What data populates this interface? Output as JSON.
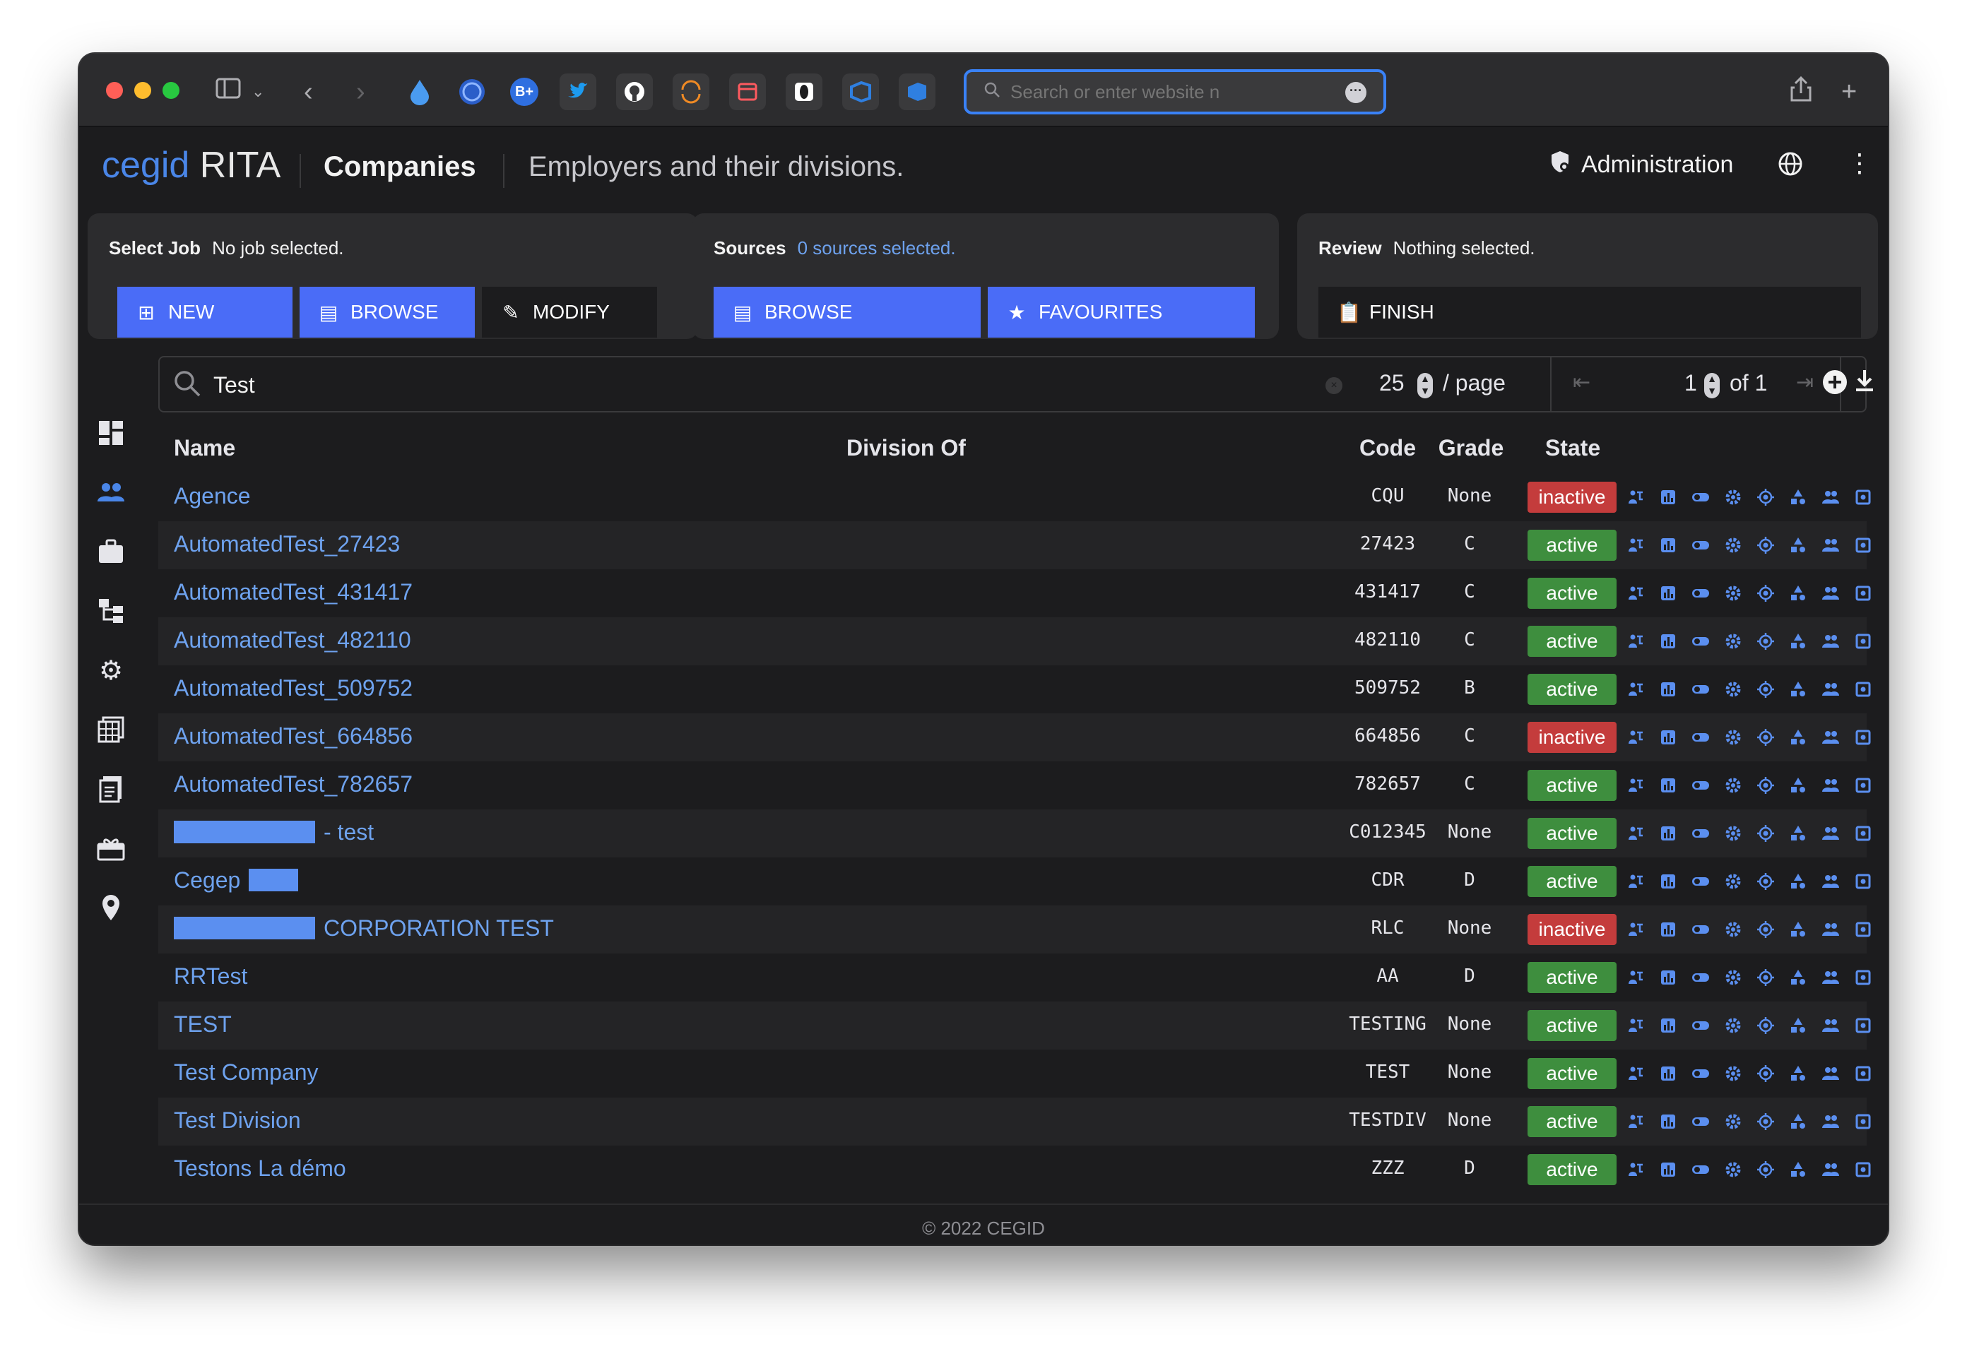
{
  "browser": {
    "url_placeholder": "Search or enter website n",
    "toolbar_icons": [
      "sidebar-icon",
      "chevron-down-icon",
      "back-icon",
      "forward-icon",
      "drop-extension-icon",
      "shield-extension-icon",
      "bplus-extension-icon",
      "twitter-icon",
      "github-icon",
      "ring-extension-icon",
      "calendar-extension-icon",
      "leaf-extension-icon",
      "azure-devops-icon",
      "azure-devops-icon-2",
      "share-icon",
      "new-tab-icon"
    ],
    "bplus_label": "B+"
  },
  "app": {
    "brand_cegid": "cegid",
    "brand_rita": "RITA",
    "page_title": "Companies",
    "page_subtitle": "Employers and their divisions.",
    "admin_label": "Administration"
  },
  "job": {
    "select_label": "Select Job",
    "select_status": "No job selected.",
    "new_label": "NEW",
    "browse_label": "BROWSE",
    "modify_label": "MODIFY"
  },
  "sources": {
    "label": "Sources",
    "status": "0 sources selected.",
    "browse_label": "BROWSE",
    "favourites_label": "FAVOURITES"
  },
  "review": {
    "label": "Review",
    "status": "Nothing selected.",
    "finish_label": "FINISH"
  },
  "search": {
    "value": "Test",
    "per_page": "25",
    "per_page_suffix": "/ page",
    "page": "1",
    "of_pages": "of 1"
  },
  "table": {
    "headers": {
      "name": "Name",
      "division_of": "Division Of",
      "code": "Code",
      "grade": "Grade",
      "state": "State"
    },
    "rows": [
      {
        "name": "Agence",
        "code": "CQU",
        "grade": "None",
        "state": "inactive"
      },
      {
        "name": "AutomatedTest_27423",
        "code": "27423",
        "grade": "C",
        "state": "active"
      },
      {
        "name": "AutomatedTest_431417",
        "code": "431417",
        "grade": "C",
        "state": "active"
      },
      {
        "name": "AutomatedTest_482110",
        "code": "482110",
        "grade": "C",
        "state": "active"
      },
      {
        "name": "AutomatedTest_509752",
        "code": "509752",
        "grade": "B",
        "state": "active"
      },
      {
        "name": "AutomatedTest_664856",
        "code": "664856",
        "grade": "C",
        "state": "inactive"
      },
      {
        "name": "AutomatedTest_782657",
        "code": "782657",
        "grade": "C",
        "state": "active"
      },
      {
        "name": "- test",
        "code": "C012345",
        "grade": "None",
        "state": "active"
      },
      {
        "name": "Cegep",
        "code": "CDR",
        "grade": "D",
        "state": "active"
      },
      {
        "name": "CORPORATION TEST",
        "code": "RLC",
        "grade": "None",
        "state": "inactive"
      },
      {
        "name": "RRTest",
        "code": "AA",
        "grade": "D",
        "state": "active"
      },
      {
        "name": "TEST",
        "code": "TESTING",
        "grade": "None",
        "state": "active"
      },
      {
        "name": "Test Company",
        "code": "TEST",
        "grade": "None",
        "state": "active"
      },
      {
        "name": "Test Division",
        "code": "TESTDIV",
        "grade": "None",
        "state": "active"
      },
      {
        "name": "Testons La démo",
        "code": "ZZZ",
        "grade": "D",
        "state": "active"
      }
    ],
    "row_action_icons": [
      "hierarchy-icon",
      "chart-icon",
      "toggle-icon",
      "settings-icon",
      "target-icon",
      "org-shapes-icon",
      "people-icon",
      "frame-icon",
      "edit-icon",
      "delete-icon"
    ]
  },
  "sidebar": {
    "icons": [
      "dashboard-icon",
      "companies-icon",
      "jobs-icon",
      "hierarchy-icon",
      "settings-icon",
      "tables-icon",
      "reports-icon",
      "gifts-icon",
      "location-icon"
    ]
  },
  "footer": {
    "copyright": "© 2022 CEGID"
  },
  "colors": {
    "accent": "#4a6cf7",
    "link": "#6ea2ee",
    "active": "#3e8e3e",
    "inactive": "#c43c3c"
  }
}
